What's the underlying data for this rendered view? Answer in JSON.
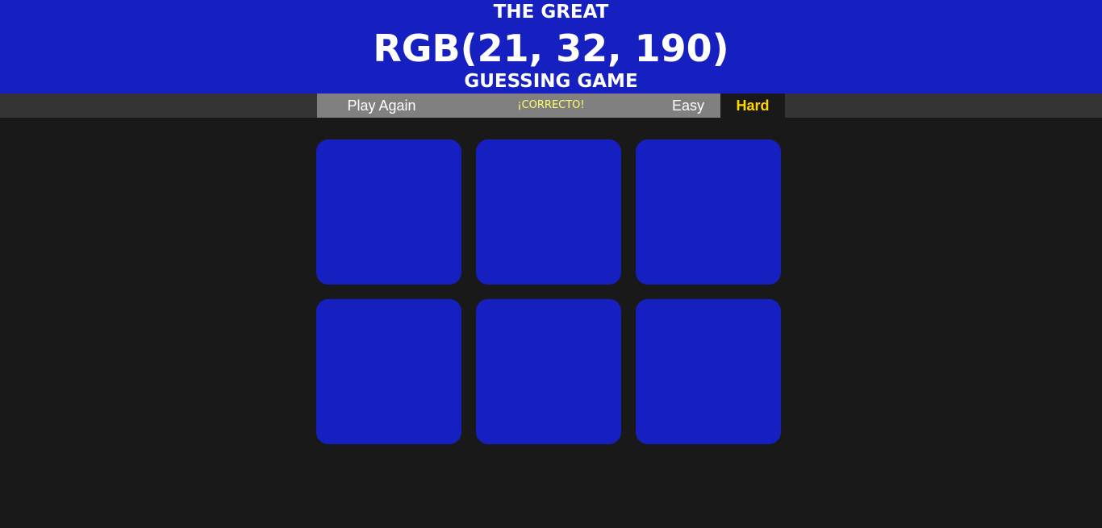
{
  "header": {
    "title_top": "THE GREAT",
    "rgb_value": "RGB(21, 32, 190)",
    "title_bottom": "GUESSING GAME",
    "background": "#1620c0"
  },
  "toolbar": {
    "reset_label": "Play Again",
    "message": "¡CORRECTO!",
    "message_color": "#ffff66",
    "easy_label": "Easy",
    "hard_label": "Hard",
    "selected_mode": "Hard",
    "selected_color": "#ffd700"
  },
  "squares": [
    {
      "color": "#1620c0"
    },
    {
      "color": "#1620c0"
    },
    {
      "color": "#1620c0"
    },
    {
      "color": "#1620c0"
    },
    {
      "color": "#1620c0"
    },
    {
      "color": "#1620c0"
    }
  ]
}
